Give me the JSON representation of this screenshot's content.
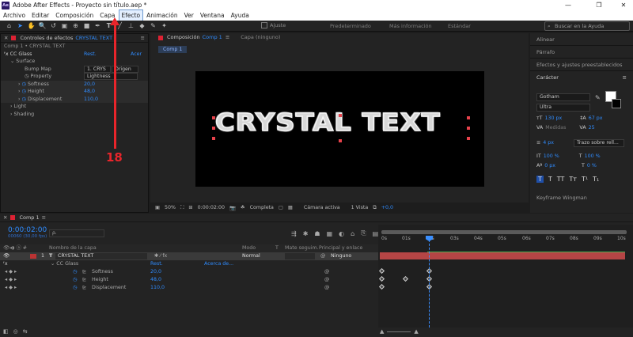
{
  "app": {
    "title": "Adobe After Effects - Proyecto sin título.aep *",
    "logo_text": "Ae"
  },
  "window_controls": {
    "min": "—",
    "max": "❐",
    "close": "✕"
  },
  "menu": [
    "Archivo",
    "Editar",
    "Composición",
    "Capa",
    "Efecto",
    "Animación",
    "Ver",
    "Ventana",
    "Ayuda"
  ],
  "toolbar": {
    "snap_label": "Ajuste",
    "workspaces": [
      "Predeterminado",
      "Más información",
      "Estándar"
    ],
    "search_placeholder": "Buscar en la Ayuda"
  },
  "effects_panel": {
    "tab": "Controles de efectos",
    "layer_tab": "CRYSTAL TEXT",
    "breadcrumb": "Comp 1 • CRYSTAL TEXT",
    "effect": "CC Glass",
    "reset": "Rest.",
    "about": "Acer",
    "surface": "Surface",
    "bump_map": "Bump Map",
    "bump_value": "1. CRYS",
    "bump_source": "Origen",
    "property": "Property",
    "property_value": "Lightness",
    "softness": "Softness",
    "softness_value": "20,0",
    "height": "Height",
    "height_value": "48,0",
    "displacement": "Displacement",
    "displacement_value": "110,0",
    "light": "Light",
    "shading": "Shading"
  },
  "comp_panel": {
    "tab": "Composición",
    "comp_tab": "Comp 1",
    "layer_tab": "Capa (ninguno)",
    "subtab": "Comp 1",
    "text": "CRYSTAL TEXT",
    "zoom": "50%",
    "time": "0:00:02:00",
    "resolution": "Completa",
    "camera": "Cámara activa",
    "views": "1 Vista",
    "offset": "+0,0"
  },
  "right_panel": {
    "sections": [
      "Alinear",
      "Párrafo",
      "Efectos y ajustes preestablecidos"
    ],
    "character": "Carácter",
    "font": "Gotham",
    "style": "Ultra",
    "size": "130 px",
    "leading": "67 px",
    "kerning": "Medidas",
    "tracking": "25",
    "stroke": "4 px",
    "stroke_type": "Trazo sobre rell...",
    "vscale": "100 %",
    "hscale": "100 %",
    "baseline": "0 px",
    "tsume": "0 %",
    "type_buttons": [
      "T",
      "T",
      "TT",
      "Tᴛ",
      "T¹",
      "T₁"
    ],
    "plugin": "Keyframe Wingman",
    "swatch_fill": "#ffffff",
    "swatch_stroke": "#000000"
  },
  "timeline": {
    "tab": "Comp 1",
    "timecode": "0:00:02:00",
    "frames": "00060 (30,00 fps)",
    "search_placeholder": "ρ.",
    "col_layer": "Nombre de la capa",
    "col_mode": "Modo",
    "col_t": "T",
    "col_matte": "Mate seguim.",
    "col_parent": "Principal y enlace",
    "layer_index": "1",
    "layer_name": "CRYSTAL TEXT",
    "mode": "Normal",
    "parent": "Ninguno",
    "effect": "CC Glass",
    "reset": "Rest.",
    "about": "Acerca de...",
    "props": [
      {
        "name": "Softness",
        "value": "20,0"
      },
      {
        "name": "Height",
        "value": "48,0"
      },
      {
        "name": "Displacement",
        "value": "110,0"
      }
    ],
    "ruler": [
      "0s",
      "01s",
      "02s",
      "03s",
      "04s",
      "05s",
      "06s",
      "07s",
      "08s",
      "09s",
      "10s"
    ]
  },
  "annotation": {
    "number": "18",
    "color": "#e8252b"
  }
}
